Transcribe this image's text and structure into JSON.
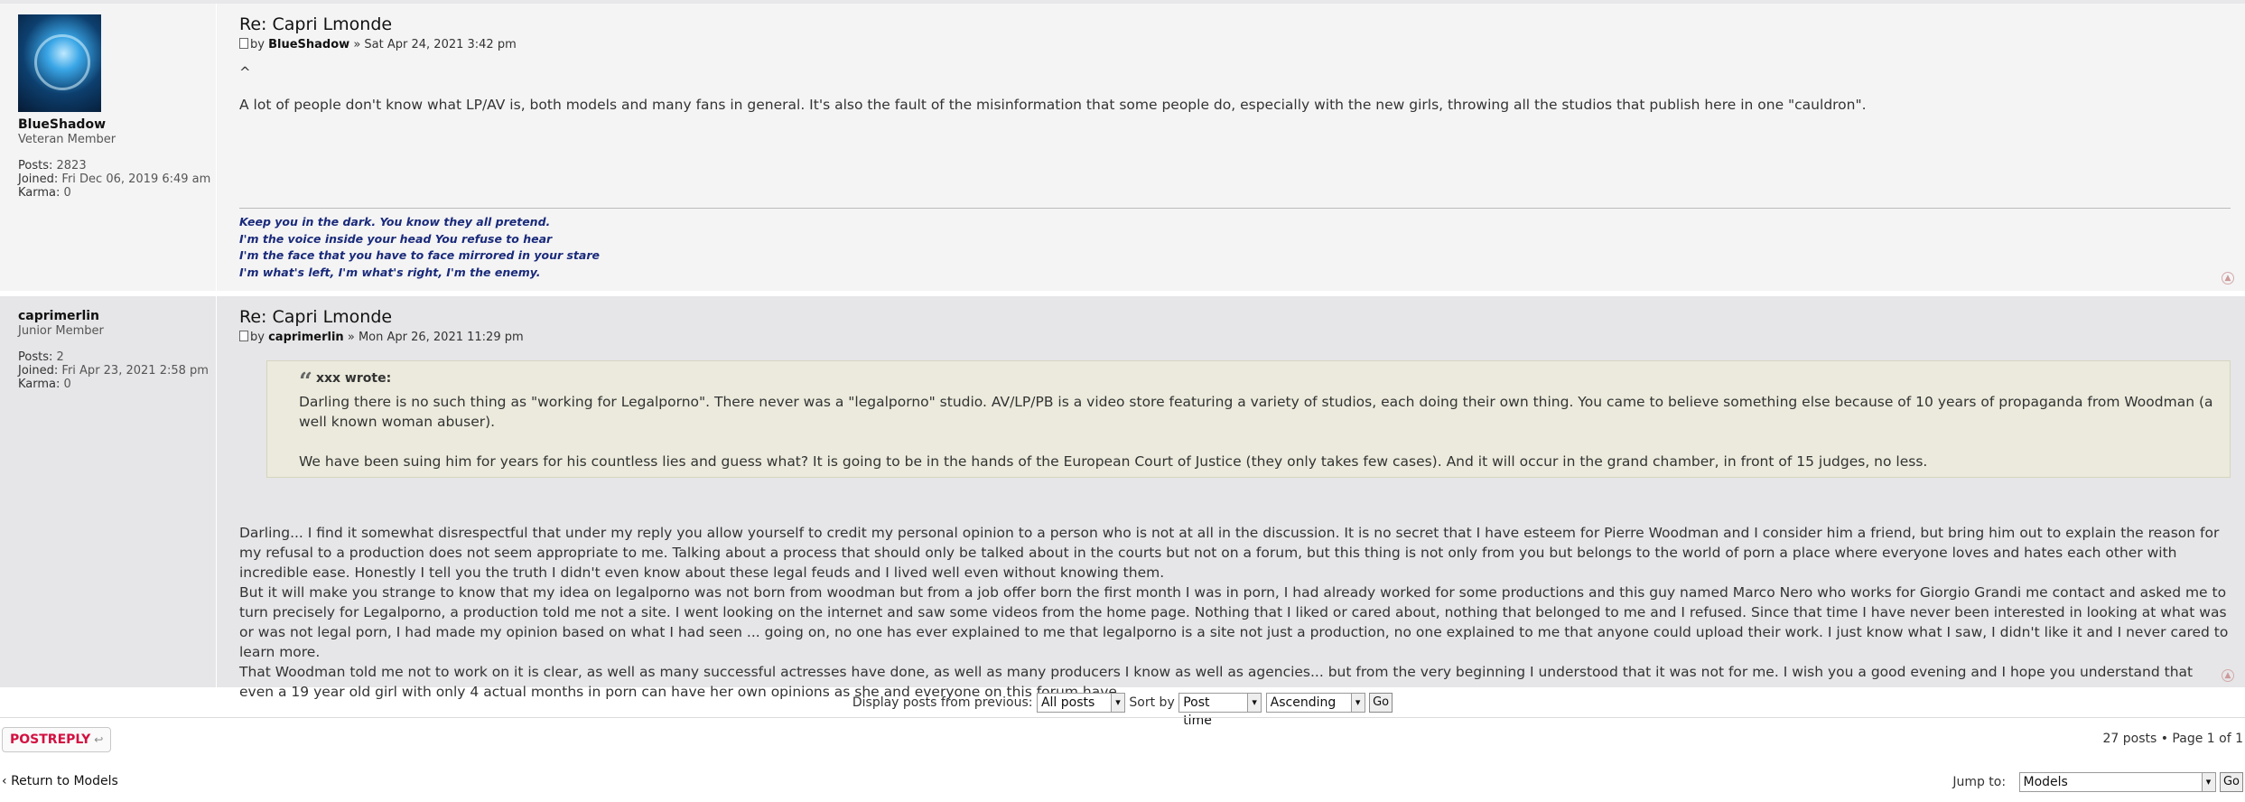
{
  "posts": [
    {
      "title": "Re: Capri Lmonde",
      "by_prefix": "by",
      "author": "BlueShadow",
      "sep": "»",
      "date": "Sat Apr 24, 2021 3:42 pm",
      "profile": {
        "username": "BlueShadow",
        "rank": "Veteran Member",
        "posts_label": "Posts:",
        "posts_value": "2823",
        "joined_label": "Joined:",
        "joined_value": "Fri Dec 06, 2019 6:49 am",
        "karma_label": "Karma:",
        "karma_value": "0"
      },
      "caret": "^",
      "body": "A lot of people don't know what LP/AV is, both models and many fans in general. It's also the fault of the misinformation that some people do, especially with the new girls, throwing all the studios that publish here in one \"cauldron\".",
      "signature": [
        "Keep you in the dark. You know they all pretend.",
        "I'm the voice inside your head You refuse to hear",
        "I'm the face that you have to face mirrored in your stare",
        "I'm what's left, I'm what's right, I'm the enemy."
      ]
    },
    {
      "title": "Re: Capri Lmonde",
      "by_prefix": "by",
      "author": "caprimerlin",
      "sep": "»",
      "date": "Mon Apr 26, 2021 11:29 pm",
      "profile": {
        "username": "caprimerlin",
        "rank": "Junior Member",
        "posts_label": "Posts:",
        "posts_value": "2",
        "joined_label": "Joined:",
        "joined_value": "Fri Apr 23, 2021 2:58 pm",
        "karma_label": "Karma:",
        "karma_value": "0"
      },
      "quote": {
        "author": "xxx wrote:",
        "paragraphs": [
          "Darling there is no such thing as \"working for Legalporno\". There never was a \"legalporno\" studio. AV/LP/PB is a video store featuring a variety of studios, each doing their own thing. You came to believe something else because of 10 years of propaganda from Woodman (a well known woman abuser).",
          "We have been suing him for years for his countless lies and guess what? It is going to be in the hands of the European Court of Justice (they only takes few cases). And it will occur in the grand chamber, in front of 15 judges, no less."
        ]
      },
      "body_lines": [
        "Darling... I find it somewhat disrespectful that under my reply you allow yourself to credit my personal opinion to a person who is not at all in the discussion. It is no secret that I have esteem for Pierre Woodman and I consider him a friend, but bring him out to explain the reason for my refusal to a production does not seem appropriate to me. Talking about a process that should only be talked about in the courts but not on a forum, but this thing is not only from you but belongs to the world of porn a place where everyone loves and hates each other with incredible ease. Honestly I tell you the truth I didn't even know about these legal feuds and I lived well even without knowing them.",
        "But it will make you strange to know that my idea on legalporno was not born from woodman but from a job offer born the first month I was in porn, I had already worked for some productions and this guy named Marco Nero who works for Giorgio Grandi me contact and asked me to turn precisely for Legalporno, a production told me not a site. I went looking on the internet and saw some videos from the home page. Nothing that I liked or cared about, nothing that belonged to me and I refused. Since that time I have never been interested in looking at what was or was not legal porn, I had made my opinion based on what I had seen ... going on, no one has ever explained to me that legalporno is a site not just a production, no one explained to me that anyone could upload their work. I just know what I saw, I didn't like it and I never cared to learn more.",
        "That Woodman told me not to work on it is clear, as well as many successful actresses have done, as well as many producers I know as well as agencies... but from the very beginning I understood that it was not for me. I wish you a good evening and I hope you understand that even a 19 year old girl with only 4 actual months in porn can have her own opinions as she and everyone on this forum have."
      ]
    }
  ],
  "sortbar": {
    "display_label": "Display posts from previous:",
    "display_value": "All posts",
    "sort_label": "Sort by",
    "sort_value": "Post time",
    "order_value": "Ascending",
    "go_label": "Go"
  },
  "actions": {
    "post_reply_label": "POSTREPLY",
    "pagination_text": "27 posts • Page 1 of 1",
    "return_label": "Return to Models",
    "jump_label": "Jump to:",
    "jump_value": "Models",
    "jump_go_label": "Go"
  },
  "icons": {
    "post_icon": "post-document-icon",
    "top_icon": "back-to-top-icon",
    "reply_icon": "reply-arrow-icon",
    "return_icon": "chevron-left-icon"
  },
  "colors": {
    "post_bg_1": "#f4f4f5",
    "post_bg_2": "#e6e6e8",
    "quote_bg": "#ebeadc",
    "signature": "#1a2a7a",
    "reply_button": "#d31141"
  }
}
